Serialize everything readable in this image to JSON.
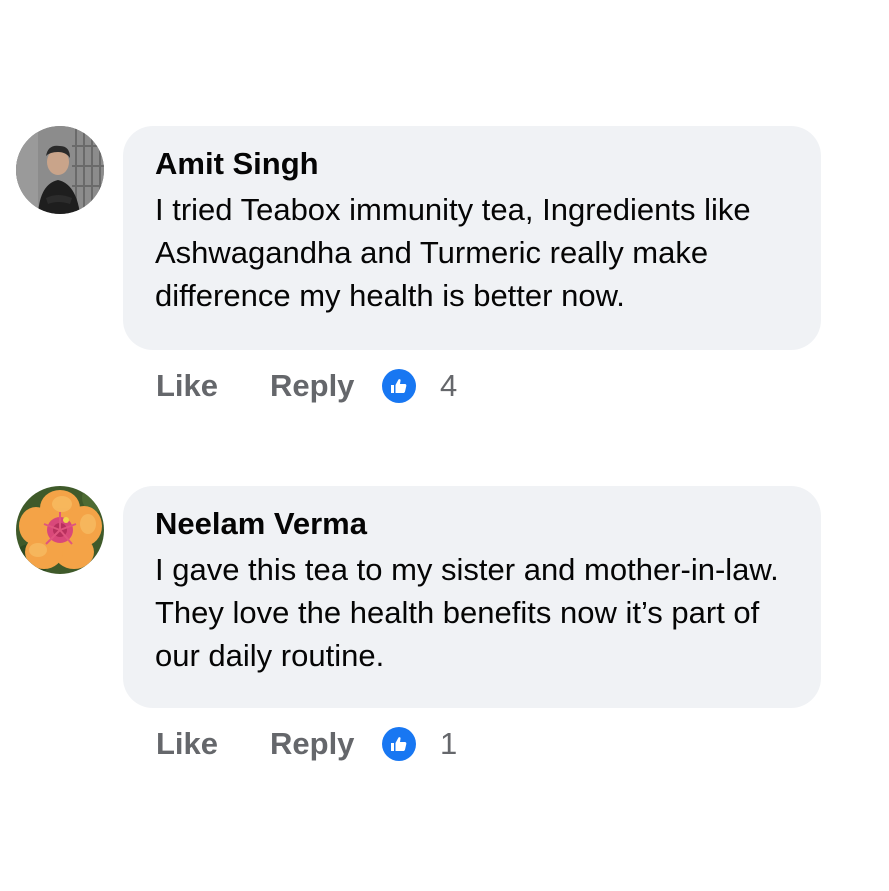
{
  "comments": [
    {
      "author": "Amit Singh",
      "text": "I tried Teabox immunity tea, Ingredients like Ashwagandha and Turmeric really make difference my health is better now.",
      "like_label": "Like",
      "reply_label": "Reply",
      "reaction_icon": "thumbs-up-icon",
      "reaction_count": "4",
      "avatar": "man-portrait-avatar"
    },
    {
      "author": "Neelam Verma",
      "text": "I gave this tea to my sister and mother-in-law. They love the health benefits now it’s part of our daily routine.",
      "like_label": "Like",
      "reply_label": "Reply",
      "reaction_icon": "thumbs-up-icon",
      "reaction_count": "1",
      "avatar": "hibiscus-flower-avatar"
    }
  ],
  "colors": {
    "bubble_bg": "#f0f2f5",
    "action_text": "#65676b",
    "reaction_blue": "#1877f2",
    "author_text": "#050505"
  }
}
